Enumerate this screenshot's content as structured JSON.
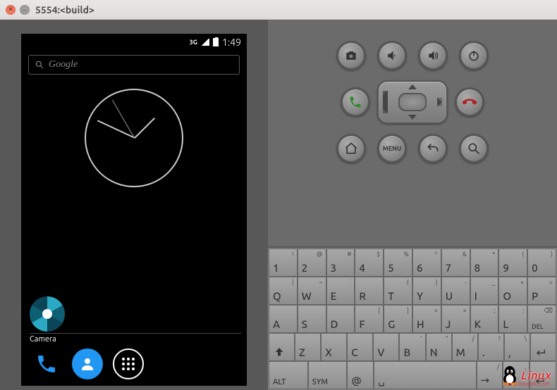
{
  "window": {
    "title": "5554:<build>"
  },
  "status": {
    "network": "3G",
    "time": "1:49"
  },
  "search": {
    "placeholder": "Google"
  },
  "homescreen": {
    "camera_label": "Camera"
  },
  "hw_buttons": {
    "menu_label": "MENU"
  },
  "keyboard": {
    "row1": [
      {
        "main": "1",
        "sup": "!"
      },
      {
        "main": "2",
        "sup": "@"
      },
      {
        "main": "3",
        "sup": "#"
      },
      {
        "main": "4",
        "sup": "$"
      },
      {
        "main": "5",
        "sup": "%"
      },
      {
        "main": "6",
        "sup": "^"
      },
      {
        "main": "7",
        "sup": "&"
      },
      {
        "main": "8",
        "sup": "*"
      },
      {
        "main": "9",
        "sup": "("
      },
      {
        "main": "0",
        "sup": ")"
      }
    ],
    "row2": [
      {
        "main": "Q",
        "sup": "|"
      },
      {
        "main": "W",
        "sup": "~"
      },
      {
        "main": "E",
        "sup": "`"
      },
      {
        "main": "R",
        "sup": ""
      },
      {
        "main": "T",
        "sup": "{"
      },
      {
        "main": "Y",
        "sup": "}"
      },
      {
        "main": "U",
        "sup": "-"
      },
      {
        "main": "I",
        "sup": "_"
      },
      {
        "main": "O",
        "sup": "+"
      },
      {
        "main": "P",
        "sup": "="
      }
    ],
    "row3": [
      {
        "main": "A",
        "sup": ""
      },
      {
        "main": "S",
        "sup": ""
      },
      {
        "main": "D",
        "sup": ""
      },
      {
        "main": "F",
        "sup": "["
      },
      {
        "main": "G",
        "sup": "]"
      },
      {
        "main": "H",
        "sup": "<"
      },
      {
        "main": "J",
        "sup": ">"
      },
      {
        "main": "K",
        "sup": ";"
      },
      {
        "main": "L",
        "sup": ":"
      }
    ],
    "row3_del": "DEL",
    "row4": [
      {
        "main": "Z",
        "sup": ""
      },
      {
        "main": "X",
        "sup": ""
      },
      {
        "main": "C",
        "sup": ""
      },
      {
        "main": "V",
        "sup": ""
      },
      {
        "main": "B",
        "sup": "'"
      },
      {
        "main": "N",
        "sup": "\""
      },
      {
        "main": "M",
        "sup": "/"
      },
      {
        "main": ".",
        "sup": "?"
      },
      {
        "main": ",",
        "sup": "\\"
      }
    ],
    "row5": {
      "alt": "ALT",
      "sym": "SYM",
      "at": "@"
    }
  },
  "watermark": {
    "text": "Linux",
    "sub": "www.linuxidc.com"
  }
}
